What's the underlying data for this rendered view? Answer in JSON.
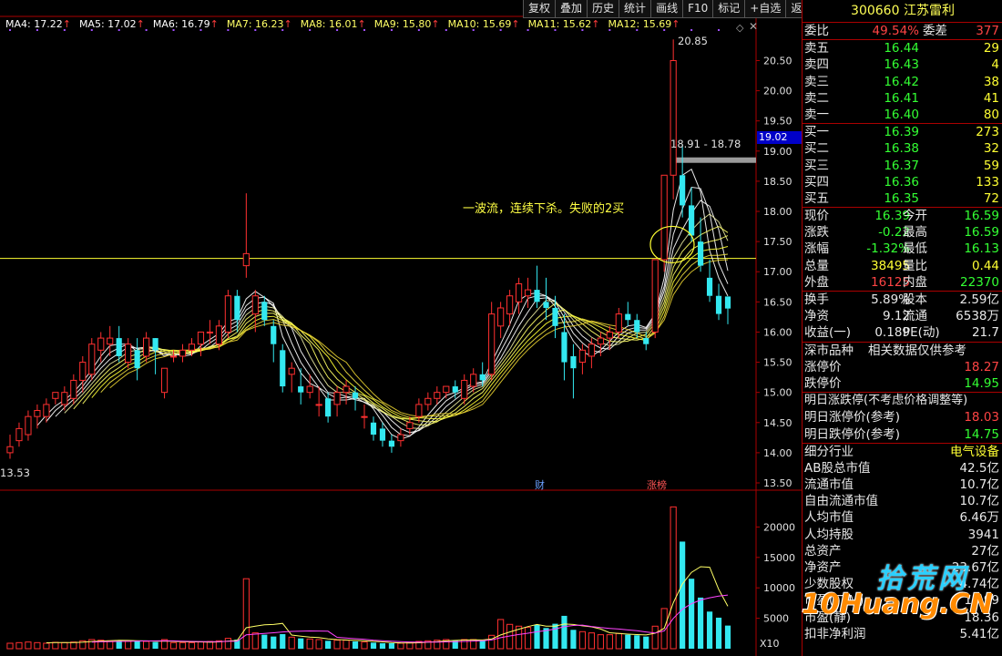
{
  "toolbar": [
    "复权",
    "叠加",
    "历史",
    "统计",
    "画线",
    "F10",
    "标记",
    "+自选",
    "返回"
  ],
  "ma_legend": [
    {
      "label": "MA4: 17.22",
      "color": "#ffffff"
    },
    {
      "label": "MA5: 17.02",
      "color": "#ffffff"
    },
    {
      "label": "MA6: 16.79",
      "color": "#ffffff"
    },
    {
      "label": "MA7: 16.23",
      "color": "#ffff66"
    },
    {
      "label": "MA8: 16.01",
      "color": "#ffff66"
    },
    {
      "label": "MA9: 15.80",
      "color": "#ffff66"
    },
    {
      "label": "MA10: 15.69",
      "color": "#ffff66"
    },
    {
      "label": "MA11: 15.62",
      "color": "#ffff66"
    },
    {
      "label": "MA12: 15.69",
      "color": "#ffff66"
    }
  ],
  "price_axis": [
    "20.50",
    "20.00",
    "19.50",
    "19.00",
    "18.50",
    "18.00",
    "17.50",
    "17.00",
    "16.50",
    "16.00",
    "15.50",
    "15.00",
    "14.50",
    "14.00",
    "13.50"
  ],
  "volume_axis": [
    "20000",
    "15000",
    "10000",
    "5000"
  ],
  "current_marker": "19.02",
  "high_label": "20.85",
  "low_label": "13.53",
  "range_label": "18.91 - 18.78",
  "annotation": "一波流，连续下杀。失败的2买",
  "event_tags": {
    "fin": "财",
    "zt": "涨榜"
  },
  "volume_unit": "X10",
  "stock": {
    "code": "300660",
    "name": "江苏雷利"
  },
  "weibi": {
    "label": "委比",
    "value": "49.54%",
    "label2": "委差",
    "value2": "377"
  },
  "asks": [
    {
      "label": "卖五",
      "price": "16.44",
      "vol": "29"
    },
    {
      "label": "卖四",
      "price": "16.43",
      "vol": "4"
    },
    {
      "label": "卖三",
      "price": "16.42",
      "vol": "38"
    },
    {
      "label": "卖二",
      "price": "16.41",
      "vol": "41"
    },
    {
      "label": "卖一",
      "price": "16.40",
      "vol": "80"
    }
  ],
  "bids": [
    {
      "label": "买一",
      "price": "16.39",
      "vol": "273"
    },
    {
      "label": "买二",
      "price": "16.38",
      "vol": "32"
    },
    {
      "label": "买三",
      "price": "16.37",
      "vol": "59"
    },
    {
      "label": "买四",
      "price": "16.36",
      "vol": "133"
    },
    {
      "label": "买五",
      "price": "16.35",
      "vol": "72"
    }
  ],
  "quote": [
    {
      "l1": "现价",
      "v1": "16.39",
      "c1": "green",
      "l2": "今开",
      "v2": "16.59",
      "c2": "green"
    },
    {
      "l1": "涨跌",
      "v1": "-0.22",
      "c1": "green",
      "l2": "最高",
      "v2": "16.59",
      "c2": "green"
    },
    {
      "l1": "涨幅",
      "v1": "-1.32%",
      "c1": "green",
      "l2": "最低",
      "v2": "16.13",
      "c2": "green"
    },
    {
      "l1": "总量",
      "v1": "38495",
      "c1": "yellow",
      "l2": "量比",
      "v2": "0.44",
      "c2": "yellow"
    },
    {
      "l1": "外盘",
      "v1": "16125",
      "c1": "red",
      "l2": "内盘",
      "v2": "22370",
      "c2": "green"
    }
  ],
  "fund": [
    {
      "l1": "换手",
      "v1": "5.89%",
      "l2": "股本",
      "v2": "2.59亿"
    },
    {
      "l1": "净资",
      "v1": "9.12",
      "l2": "流通",
      "v2": "6538万"
    },
    {
      "l1": "收益(一)",
      "v1": "0.189",
      "l2": "PE(动)",
      "v2": "21.7"
    }
  ],
  "market": {
    "label": "深市品种",
    "note": "相关数据仅供参考"
  },
  "limits": [
    {
      "label": "涨停价",
      "value": "18.27",
      "color": "red"
    },
    {
      "label": "跌停价",
      "value": "14.95",
      "color": "green"
    }
  ],
  "next_title": "明日涨跌停(不考虑价格调整等)",
  "next": [
    {
      "label": "明日涨停价(参考)",
      "value": "18.03",
      "color": "red"
    },
    {
      "label": "明日跌停价(参考)",
      "value": "14.75",
      "color": "green"
    }
  ],
  "industry": {
    "label": "细分行业",
    "value": "电气设备"
  },
  "stats": [
    {
      "label": "AB股总市值",
      "value": "42.5亿"
    },
    {
      "label": "流通市值",
      "value": "10.7亿"
    },
    {
      "label": "自由流通市值",
      "value": "10.7亿"
    },
    {
      "label": "人均市值",
      "value": "6.46万"
    },
    {
      "label": "人均持股",
      "value": "3941"
    },
    {
      "label": "总资产",
      "value": "27亿"
    },
    {
      "label": "净资产",
      "value": "23.67亿"
    },
    {
      "label": "少数股权",
      "value": "4.74亿"
    },
    {
      "label": "市盈(TTM)",
      "value": "17.99"
    },
    {
      "label": "市盈(静)",
      "value": "18.36"
    },
    {
      "label": "扣非净利润",
      "value": "5.41亿"
    }
  ],
  "watermark": {
    "top": "拾荒网",
    "bottom": "10Huang.CN"
  },
  "chart_data": {
    "type": "candlestick",
    "ylim": [
      13.5,
      20.9
    ],
    "candles": [
      [
        14.0,
        14.3,
        13.9,
        14.1
      ],
      [
        14.2,
        14.5,
        14.1,
        14.4
      ],
      [
        14.3,
        14.7,
        14.2,
        14.6
      ],
      [
        14.6,
        14.8,
        14.4,
        14.7
      ],
      [
        14.6,
        14.9,
        14.5,
        14.8
      ],
      [
        14.9,
        15.0,
        14.8,
        15.0
      ],
      [
        14.8,
        15.1,
        14.7,
        15.0
      ],
      [
        14.9,
        15.3,
        14.8,
        15.2
      ],
      [
        15.2,
        15.6,
        15.0,
        15.5
      ],
      [
        15.3,
        15.9,
        15.2,
        15.8
      ],
      [
        15.7,
        16.0,
        15.5,
        15.9
      ],
      [
        15.8,
        16.1,
        15.6,
        15.9
      ],
      [
        15.9,
        16.1,
        15.5,
        15.6
      ],
      [
        15.5,
        15.9,
        15.4,
        15.8
      ],
      [
        15.7,
        15.9,
        15.2,
        15.4
      ],
      [
        15.6,
        16.0,
        15.5,
        15.9
      ],
      [
        15.9,
        15.9,
        15.3,
        15.7
      ],
      [
        15.0,
        15.4,
        14.9,
        15.4
      ],
      [
        15.6,
        15.7,
        15.5,
        15.6
      ],
      [
        15.6,
        15.8,
        15.5,
        15.7
      ],
      [
        15.7,
        15.9,
        15.6,
        15.8
      ],
      [
        15.8,
        16.0,
        15.6,
        16.0
      ],
      [
        16.0,
        16.2,
        15.8,
        16.0
      ],
      [
        15.8,
        16.2,
        15.7,
        16.1
      ],
      [
        16.0,
        16.7,
        15.9,
        16.6
      ],
      [
        16.6,
        16.7,
        16.0,
        16.2
      ],
      [
        17.1,
        18.3,
        16.9,
        17.3
      ],
      [
        16.3,
        16.7,
        16.0,
        16.6
      ],
      [
        16.5,
        16.6,
        16.1,
        16.2
      ],
      [
        16.1,
        16.2,
        15.5,
        15.8
      ],
      [
        15.7,
        15.8,
        15.0,
        15.1
      ],
      [
        15.3,
        15.5,
        15.0,
        15.4
      ],
      [
        15.1,
        15.4,
        14.8,
        15.0
      ],
      [
        15.0,
        15.3,
        14.9,
        15.1
      ],
      [
        14.8,
        15.1,
        14.6,
        14.8
      ],
      [
        14.9,
        15.0,
        14.5,
        14.6
      ],
      [
        14.8,
        15.1,
        14.6,
        15.0
      ],
      [
        15.0,
        15.2,
        14.8,
        15.1
      ],
      [
        15.0,
        15.1,
        14.7,
        14.9
      ],
      [
        14.6,
        14.8,
        14.4,
        14.6
      ],
      [
        14.5,
        14.6,
        14.2,
        14.3
      ],
      [
        14.4,
        14.5,
        14.1,
        14.2
      ],
      [
        14.2,
        14.3,
        14.0,
        14.1
      ],
      [
        14.2,
        14.4,
        14.1,
        14.3
      ],
      [
        14.4,
        14.6,
        14.3,
        14.5
      ],
      [
        14.6,
        14.9,
        14.5,
        14.8
      ],
      [
        14.8,
        15.0,
        14.7,
        14.9
      ],
      [
        14.9,
        15.1,
        14.8,
        15.0
      ],
      [
        15.0,
        15.1,
        14.9,
        15.1
      ],
      [
        15.1,
        15.2,
        14.9,
        15.0
      ],
      [
        14.9,
        15.3,
        14.8,
        15.2
      ],
      [
        15.1,
        15.4,
        15.0,
        15.3
      ],
      [
        15.3,
        15.5,
        15.1,
        15.2
      ],
      [
        15.3,
        16.5,
        15.2,
        16.3
      ],
      [
        16.1,
        16.5,
        15.9,
        16.4
      ],
      [
        16.3,
        16.7,
        16.1,
        16.6
      ],
      [
        16.5,
        16.9,
        16.3,
        16.8
      ],
      [
        16.6,
        16.9,
        16.4,
        16.7
      ],
      [
        16.7,
        17.1,
        16.4,
        16.5
      ],
      [
        16.5,
        16.9,
        16.2,
        16.4
      ],
      [
        16.4,
        16.6,
        15.9,
        16.1
      ],
      [
        16.0,
        16.3,
        15.2,
        15.5
      ],
      [
        15.6,
        15.8,
        14.9,
        15.4
      ],
      [
        15.5,
        15.8,
        15.3,
        15.7
      ],
      [
        15.6,
        15.9,
        15.4,
        15.8
      ],
      [
        15.8,
        16.0,
        15.6,
        15.9
      ],
      [
        15.9,
        16.1,
        15.7,
        16.0
      ],
      [
        16.0,
        16.4,
        15.9,
        16.3
      ],
      [
        16.3,
        16.5,
        16.1,
        16.2
      ],
      [
        16.2,
        16.3,
        15.9,
        16.0
      ],
      [
        15.9,
        16.0,
        15.7,
        15.8
      ],
      [
        16.0,
        17.2,
        15.9,
        17.2
      ],
      [
        17.2,
        18.6,
        17.0,
        18.6
      ],
      [
        18.6,
        20.85,
        18.2,
        20.5
      ],
      [
        18.6,
        19.1,
        17.9,
        18.1
      ],
      [
        18.1,
        18.4,
        17.5,
        17.6
      ],
      [
        17.5,
        17.9,
        17.0,
        17.1
      ],
      [
        16.9,
        17.2,
        16.5,
        16.6
      ],
      [
        16.6,
        16.8,
        16.2,
        16.3
      ],
      [
        16.59,
        16.59,
        16.13,
        16.39
      ]
    ],
    "volume": [
      900,
      1000,
      1100,
      1000,
      900,
      1050,
      1000,
      1100,
      1300,
      1500,
      1400,
      1300,
      1400,
      1200,
      1300,
      1200,
      1100,
      1500,
      1000,
      1000,
      1000,
      1100,
      1200,
      1300,
      1700,
      1500,
      11500,
      2600,
      2300,
      2000,
      2400,
      1900,
      1700,
      1600,
      1500,
      1300,
      1400,
      1400,
      1200,
      1100,
      1000,
      900,
      900,
      900,
      1000,
      1200,
      1300,
      1400,
      1500,
      1400,
      1500,
      1500,
      1300,
      2200,
      4800,
      4000,
      3700,
      3500,
      3900,
      3400,
      4100,
      5400,
      3100,
      2800,
      2600,
      2300,
      2300,
      2500,
      2300,
      2200,
      2000,
      3700,
      6600,
      23300,
      17600,
      11500,
      8400,
      6100,
      5100,
      3800
    ],
    "ma_fast_hint": "white lines MA4-MA6, yellow lines MA7-MA12"
  }
}
